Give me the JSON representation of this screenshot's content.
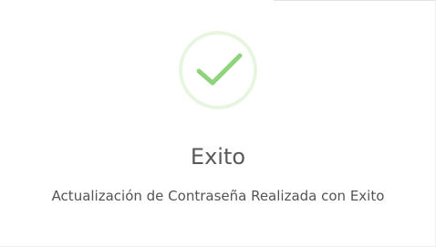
{
  "dialog": {
    "icon": "success-check-icon",
    "title": "Exito",
    "message": "Actualización de Contraseña Realizada con Exito"
  },
  "colors": {
    "success_ring": "#e8f5e0",
    "success_check": "#8fd47c",
    "title": "#595959",
    "message": "#545454",
    "background": "#ffffff"
  }
}
